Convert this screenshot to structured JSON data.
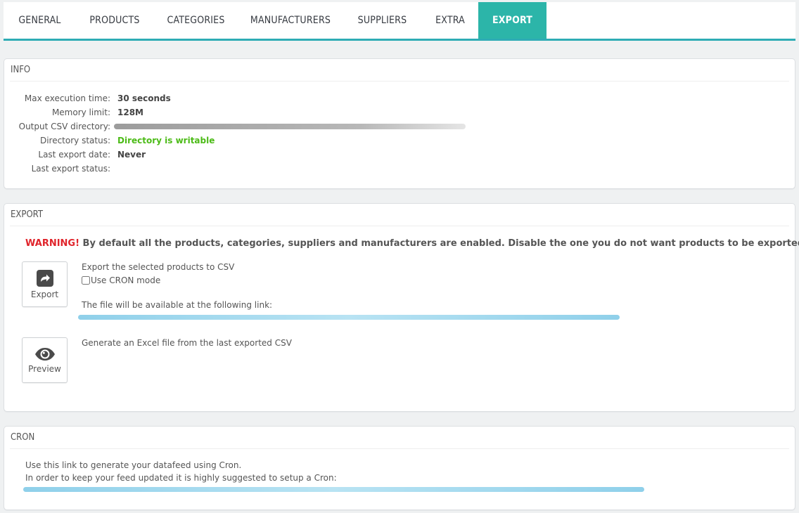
{
  "tabs": [
    {
      "label": "GENERAL"
    },
    {
      "label": "PRODUCTS"
    },
    {
      "label": "CATEGORIES"
    },
    {
      "label": "MANUFACTURERS"
    },
    {
      "label": "SUPPLIERS"
    },
    {
      "label": "EXTRA"
    },
    {
      "label": "EXPORT",
      "active": true
    }
  ],
  "info": {
    "heading": "INFO",
    "rows": [
      {
        "label": "Max execution time:",
        "value": "30 seconds"
      },
      {
        "label": "Memory limit:",
        "value": "128M"
      },
      {
        "label": "Output CSV directory:",
        "value": ""
      },
      {
        "label": "Directory status:",
        "value": "Directory is writable"
      },
      {
        "label": "Last export date:",
        "value": "Never"
      },
      {
        "label": "Last export status:",
        "value": ""
      }
    ]
  },
  "export": {
    "heading": "EXPORT",
    "warning_label": "WARNING!",
    "warning_text": " By default all the products, categories, suppliers and manufacturers are enabled. Disable the one you do not want products to be exported.",
    "export_button": {
      "label": "Export",
      "icon": "share-icon"
    },
    "export_description": "Export the selected products to CSV",
    "cron_mode_label": "Use CRON mode",
    "cron_mode_checked": false,
    "link_note": "The file will be available at the following link:",
    "preview_button": {
      "label": "Preview",
      "icon": "eye-icon"
    },
    "preview_description": "Generate an Excel file from the last exported CSV"
  },
  "cron": {
    "heading": "CRON",
    "line1": "Use this link to generate your datafeed using Cron.",
    "line2": "In order to keep your feed updated it is highly suggested to setup a Cron:"
  },
  "colors": {
    "accent": "#2cb5a9",
    "warning": "#e0242b",
    "success": "#4cbb17"
  }
}
